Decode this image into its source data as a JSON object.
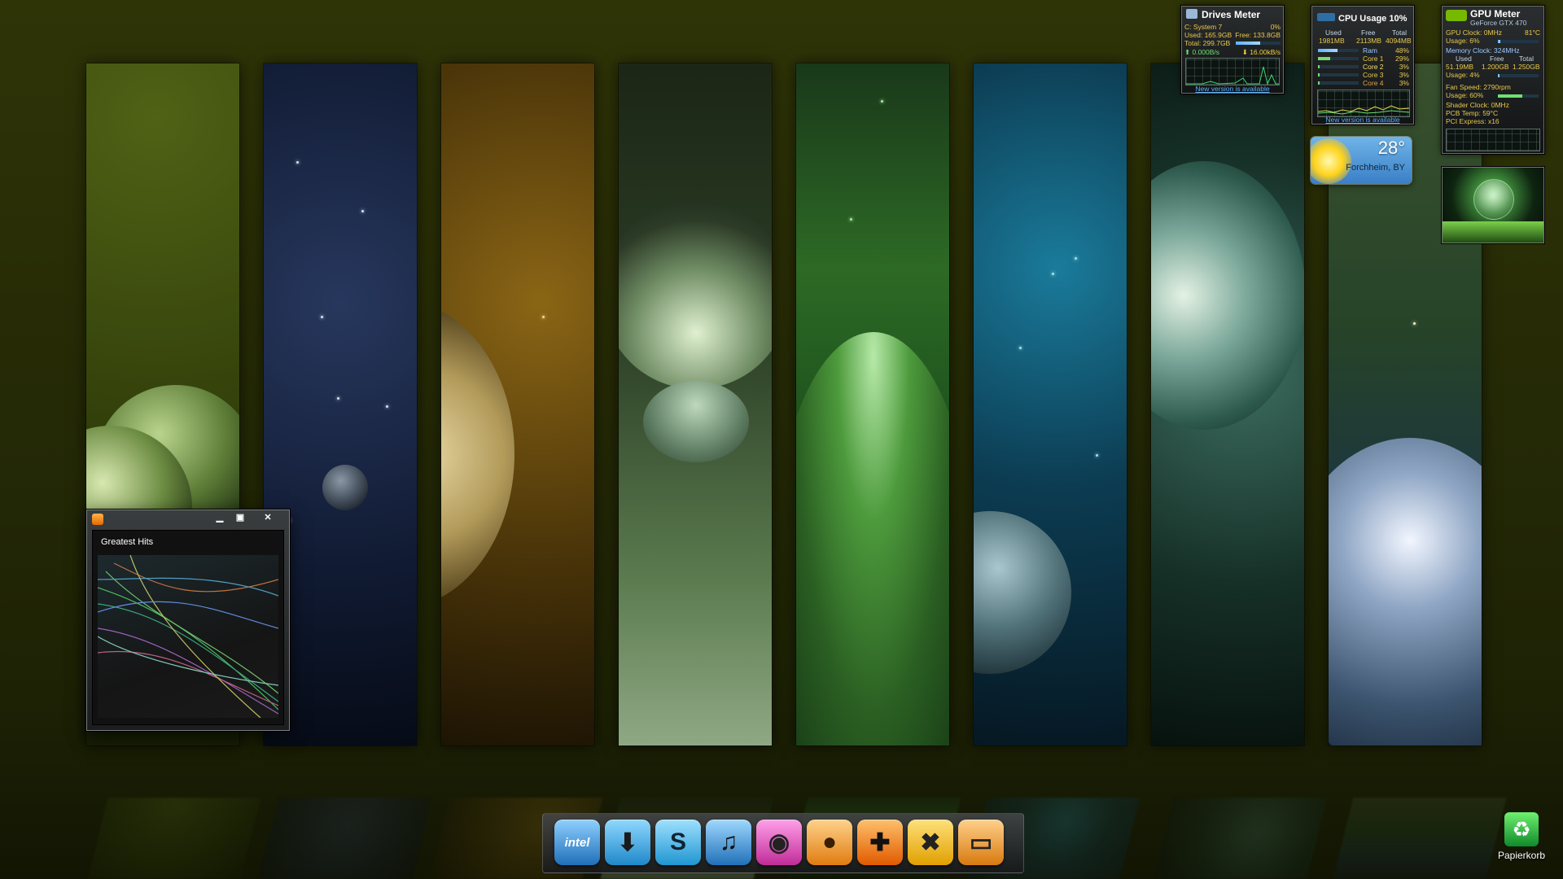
{
  "drives_meter": {
    "title": "Drives Meter",
    "drive": "C: System 7",
    "percent": "0%",
    "used": "Used: 165.9GB",
    "free": "Free: 133.8GB",
    "total": "Total: 299.7GB",
    "read_rate": "0.000B/s",
    "write_rate": "16.00kB/s",
    "update_link": "New version is available"
  },
  "cpu_meter": {
    "title": "CPU Usage 10%",
    "headers": [
      "Used",
      "Free",
      "Total"
    ],
    "values": [
      "1981MB",
      "2113MB",
      "4094MB"
    ],
    "rows": [
      {
        "label": "Ram",
        "value": "48%",
        "level": 0.48
      },
      {
        "label": "Core 1",
        "value": "29%",
        "level": 0.29
      },
      {
        "label": "Core 2",
        "value": "3%",
        "level": 0.03
      },
      {
        "label": "Core 3",
        "value": "3%",
        "level": 0.03
      },
      {
        "label": "Core 4",
        "value": "3%",
        "level": 0.03
      }
    ],
    "update_link": "New version is available"
  },
  "gpu_meter": {
    "title": "GPU Meter",
    "model": "GeForce GTX 470",
    "gpu_clock": "GPU Clock: 0MHz",
    "temp": "81°C",
    "usage": "Usage: 6%",
    "memory_clock": "Memory Clock: 324MHz",
    "mem_headers": [
      "Used",
      "Free",
      "Total"
    ],
    "mem_values": [
      "51.19MB",
      "1.200GB",
      "1.250GB"
    ],
    "mem_usage": "Usage: 4%",
    "fan_speed": "Fan Speed: 2790rpm",
    "fan_usage": "Usage: 60%",
    "shader_clock": "Shader Clock: 0MHz",
    "pcb_temp": "PCB Temp: 59°C",
    "pci_express": "PCI Express: x16"
  },
  "weather": {
    "temperature": "28°",
    "location": "Forchheim, BY"
  },
  "media_player": {
    "title": "Greatest Hits",
    "minimize_glyph": "▁",
    "maximize_glyph": "▣",
    "close_glyph": "✕"
  },
  "dock": {
    "icons": [
      {
        "name": "intel-icon",
        "label": "intel",
        "color": "#3a8ed0"
      },
      {
        "name": "download-icon",
        "label": "⬇",
        "color": "#2f9ad8"
      },
      {
        "name": "skype-icon",
        "label": "S",
        "color": "#26a8de"
      },
      {
        "name": "music-icon",
        "label": "♫",
        "color": "#2a7fc8"
      },
      {
        "name": "camera-icon",
        "label": "◉",
        "color": "#c83ca8"
      },
      {
        "name": "firefox-icon",
        "label": "●",
        "color": "#e88a1e"
      },
      {
        "name": "gamepad-icon",
        "label": "✚",
        "color": "#e06a10"
      },
      {
        "name": "tools-icon",
        "label": "✖",
        "color": "#e0a010"
      },
      {
        "name": "display-icon",
        "label": "▭",
        "color": "#d8861a"
      }
    ]
  },
  "recycle_bin": {
    "label": "Papierkorb"
  }
}
